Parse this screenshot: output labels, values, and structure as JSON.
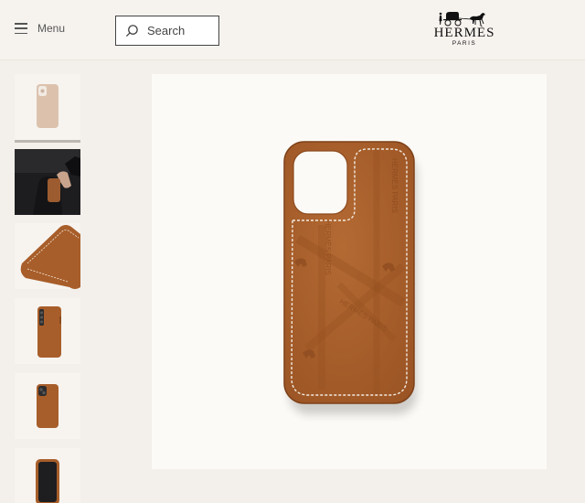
{
  "header": {
    "menu_label": "Menu",
    "search_label": "Search",
    "brand_name": "HERMÈS",
    "brand_sub": "PARIS"
  },
  "gallery": {
    "thumbnails": [
      {
        "subject": "case-beige",
        "selected": true
      },
      {
        "subject": "case-in-hand",
        "selected": false
      },
      {
        "subject": "case-corner-detail",
        "selected": false
      },
      {
        "subject": "case-side-view",
        "selected": false
      },
      {
        "subject": "case-back-small",
        "selected": false
      },
      {
        "subject": "case-front-small",
        "selected": false
      }
    ]
  },
  "product": {
    "case_color": "#a85e2a",
    "stitch_color": "#f3ebe0",
    "embossed_text": "HERMÈS PARIS"
  },
  "colors": {
    "page_bg": "#f3efea",
    "header_bg": "#f6f3ef",
    "image_bg": "#fcfaf6"
  }
}
